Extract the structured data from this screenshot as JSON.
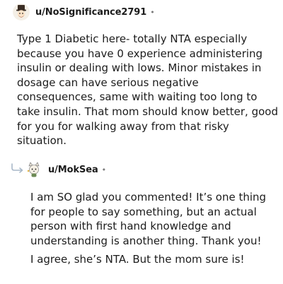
{
  "comment": {
    "username": "u/NoSignificance2791",
    "separator": "•",
    "avatar_icon": "snoo-avatar-top-hat-icon",
    "body": "Type 1 Diabetic here- totally NTA especially because you have 0 experience administering insulin or dealing with lows. Minor mistakes in dosage can have serious negative consequences, same with waiting too long to take insulin. That mom should know better, good for you for walking away from that risky situation."
  },
  "reply": {
    "indicator_icon": "reply-arrow-icon",
    "username": "u/MokSea",
    "separator": "•",
    "avatar_icon": "snoo-avatar-cat-ears-icon",
    "paragraphs": [
      "I am SO glad you commented! It’s one thing for people to say something, but an actual person with first hand knowledge and understanding is another thing. Thank you!",
      "I agree, she’s NTA. But the mom sure is!"
    ]
  },
  "colors": {
    "text": "#1c1c1c",
    "meta": "#7c7c7c",
    "reply_arrow": "#a8b8c8"
  }
}
